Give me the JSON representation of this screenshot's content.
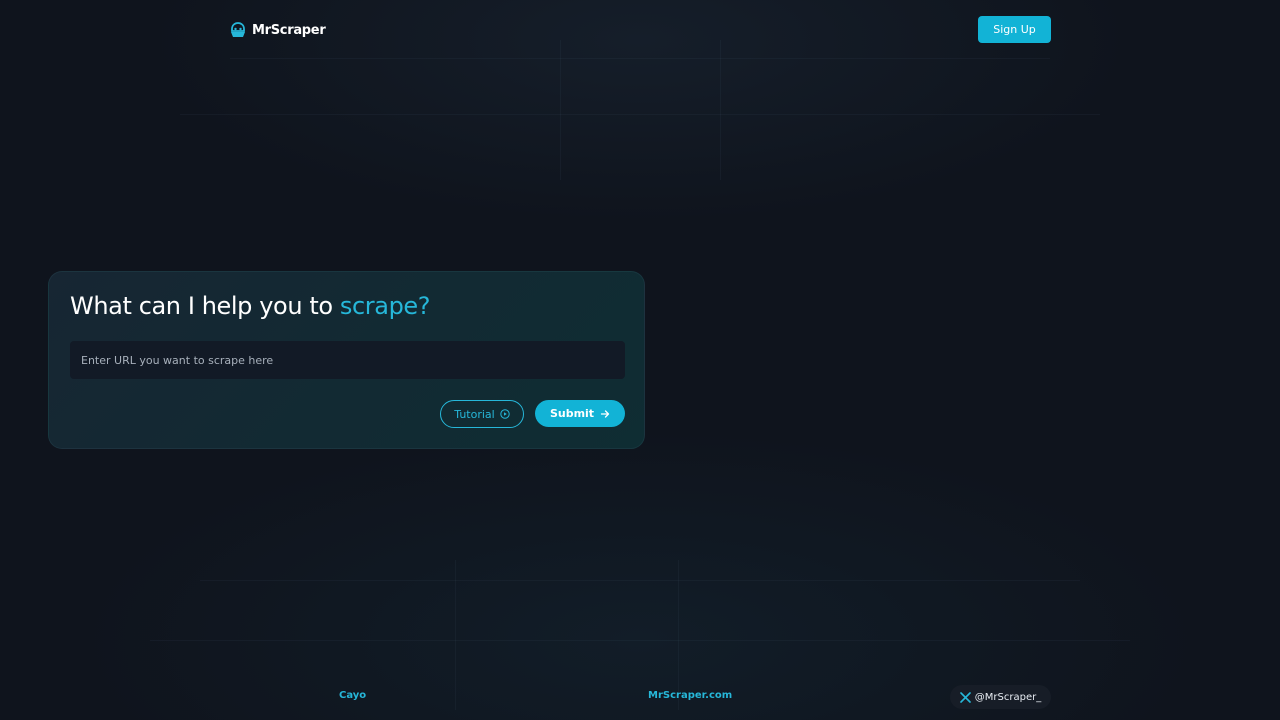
{
  "header": {
    "brand": "MrScraper",
    "signup_label": "Sign Up"
  },
  "card": {
    "headline_prefix": "What can I help you to ",
    "headline_accent": "scrape?",
    "url_placeholder": "Enter URL you want to scrape here",
    "url_value": "",
    "tutorial_label": "Tutorial",
    "submit_label": "Submit"
  },
  "footer": {
    "left_link": "Cayo",
    "center_link": "MrScraper.com",
    "social_handle": "@MrScraper_"
  },
  "icons": {
    "logo": "mrscraper-logo-icon",
    "tutorial": "play-circle-icon",
    "submit": "arrow-right-icon",
    "social": "x-icon"
  },
  "colors": {
    "background": "#0f141d",
    "accent": "#26b7d9",
    "button": "#12b3d6",
    "card": "#142a33",
    "input": "#121a26"
  }
}
